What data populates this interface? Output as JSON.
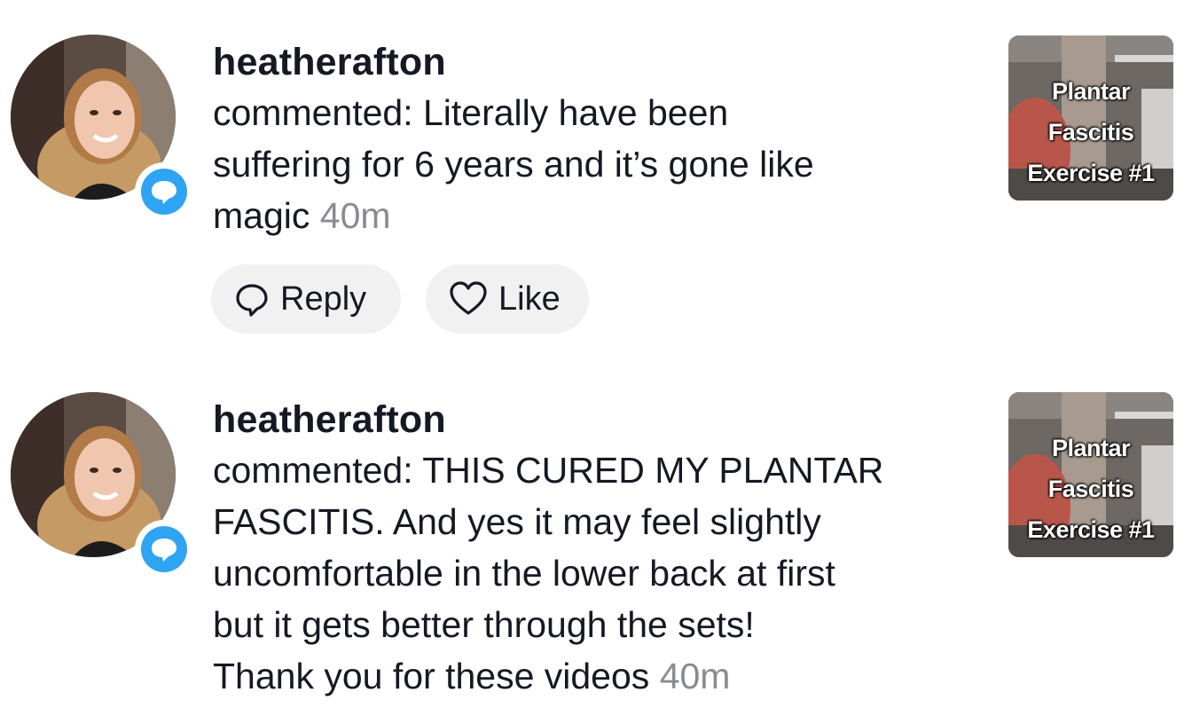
{
  "notifications": [
    {
      "username": "heatherafton",
      "comment_lines": [
        "commented: Literally have been",
        "suffering for 6 years and it’s gone like",
        "magic"
      ],
      "time": "40m",
      "reply_label": "Reply",
      "like_label": "Like",
      "thumbnail_caption": [
        "Plantar",
        "Fascitis",
        "Exercise #1"
      ]
    },
    {
      "username": "heatherafton",
      "comment_lines": [
        "commented: THIS CURED MY PLANTAR",
        "FASCITIS. And yes it may feel slightly",
        "uncomfortable in the lower back at first",
        "but it gets better through the sets!",
        "Thank you for these videos"
      ],
      "time": "40m",
      "thumbnail_caption": [
        "Plantar",
        "Fascitis",
        "Exercise #1"
      ]
    }
  ],
  "colors": {
    "badge": "#2ea4f2",
    "time": "#8a8b91",
    "pill_bg": "#f1f1f2"
  },
  "icons": {
    "badge": "comment-bubble-icon",
    "reply": "reply-bubble-icon",
    "like": "heart-outline-icon"
  }
}
